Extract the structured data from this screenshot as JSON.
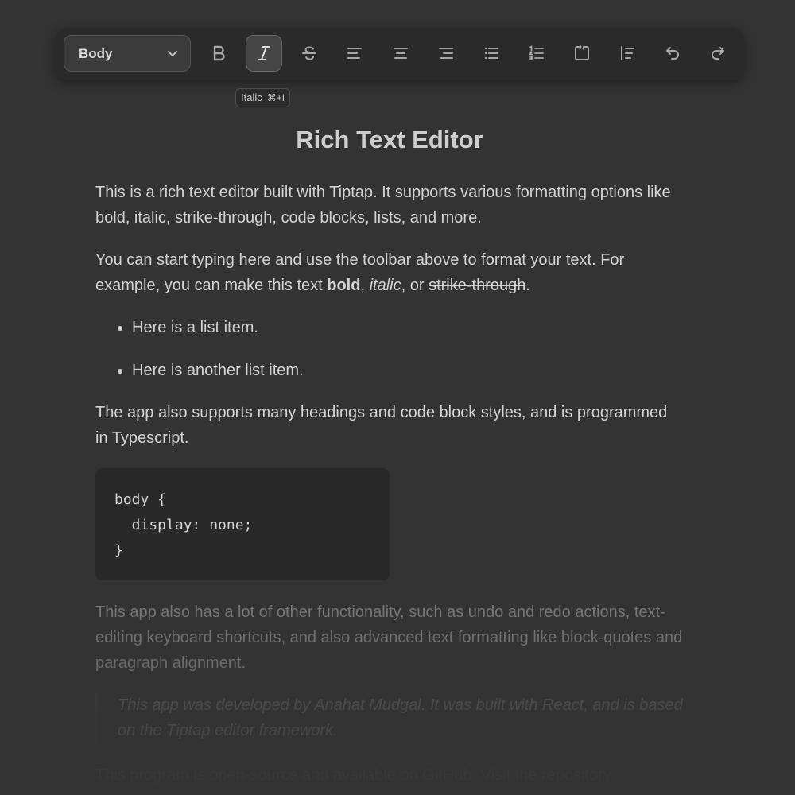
{
  "toolbar": {
    "style_select": {
      "value": "Body"
    },
    "buttons": [
      {
        "name": "bold",
        "icon": "bold-icon"
      },
      {
        "name": "italic",
        "icon": "italic-icon",
        "active": true
      },
      {
        "name": "strikethrough",
        "icon": "strikethrough-icon"
      },
      {
        "name": "align-left",
        "icon": "align-left-icon"
      },
      {
        "name": "align-center",
        "icon": "align-center-icon"
      },
      {
        "name": "align-right",
        "icon": "align-right-icon"
      },
      {
        "name": "bullet-list",
        "icon": "bullet-list-icon"
      },
      {
        "name": "ordered-list",
        "icon": "ordered-list-icon"
      },
      {
        "name": "code-block",
        "icon": "code-block-icon"
      },
      {
        "name": "blockquote",
        "icon": "blockquote-icon"
      },
      {
        "name": "undo",
        "icon": "undo-icon"
      },
      {
        "name": "redo",
        "icon": "redo-icon"
      }
    ]
  },
  "tooltip": {
    "label": "Italic",
    "shortcut": "⌘+I"
  },
  "document": {
    "title": "Rich Text Editor",
    "p1": "This is a rich text editor built with Tiptap. It supports various formatting options like bold, italic, strike-through, code blocks, lists, and more.",
    "p2": {
      "text": "You can start typing here and use the toolbar above to format your text. For example, you can make this text ",
      "bold": "bold",
      "sep1": ", ",
      "italic": "italic",
      "sep2": ", or ",
      "strike": "strike-through",
      "end": "."
    },
    "list": [
      "Here is a list item.",
      "Here is another list item."
    ],
    "p3": "The app also supports many headings and code block styles, and is programmed in Typescript.",
    "code": "body {\n  display: none;\n}",
    "p4": "This app also has a lot of other functionality, such as undo and redo actions, text-editing keyboard shortcuts, and also advanced text formatting like block-quotes and paragraph alignment.",
    "quote": "This app was developed by Anahat Mudgal. It was built with React, and is based on the Tiptap editor framework.",
    "p5": "This program is open-source and available on GitHub. Visit the repository"
  },
  "colors": {
    "background": "#333333",
    "toolbar": "#2a2a2a",
    "text": "#d3d3d3",
    "code_background": "#292929"
  }
}
